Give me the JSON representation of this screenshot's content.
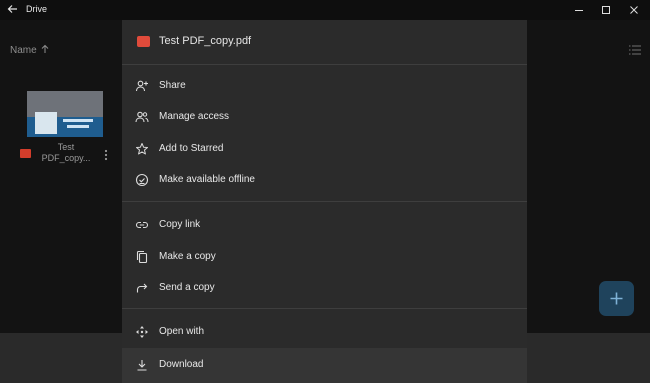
{
  "window": {
    "title": "Drive"
  },
  "toolbar": {
    "sort_label": "Name"
  },
  "file_card": {
    "name": "Test PDF_copy..."
  },
  "menu": {
    "header": "Test PDF_copy.pdf",
    "items": [
      {
        "label": "Share",
        "icon": "person-add-icon"
      },
      {
        "label": "Manage access",
        "icon": "people-icon"
      },
      {
        "label": "Add to Starred",
        "icon": "star-icon"
      },
      {
        "label": "Make available offline",
        "icon": "offline-pin-icon"
      },
      {
        "label": "Copy link",
        "icon": "link-icon"
      },
      {
        "label": "Make a copy",
        "icon": "copy-icon"
      },
      {
        "label": "Send a copy",
        "icon": "forward-icon"
      },
      {
        "label": "Open with",
        "icon": "open-with-icon"
      },
      {
        "label": "Download",
        "icon": "download-icon"
      }
    ]
  },
  "colors": {
    "menu_bg": "#2b2b2b",
    "fab": "#1f435c",
    "pdf_red": "#e04b3b"
  }
}
